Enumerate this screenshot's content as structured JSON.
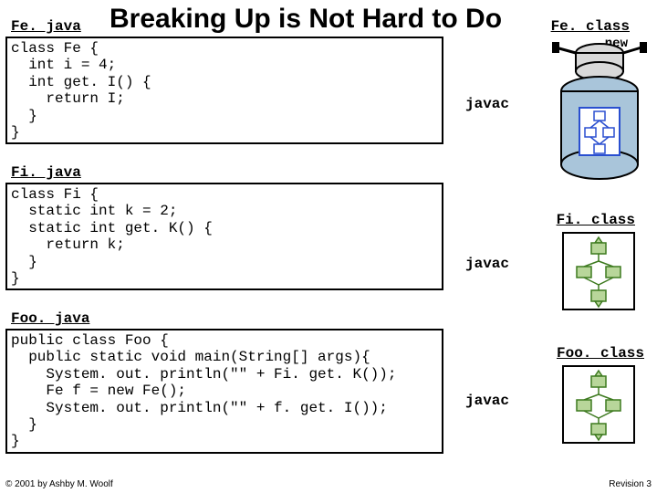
{
  "title": "Breaking Up is Not Hard to Do",
  "files": {
    "fe": {
      "label": "Fe. java",
      "code": "class Fe {\n  int i = 4;\n  int get. I() {\n    return I;\n  }\n}",
      "compiler": "javac",
      "class_label": "Fe. class"
    },
    "fi": {
      "label": "Fi. java",
      "code": "class Fi {\n  static int k = 2;\n  static int get. K() {\n    return k;\n  }\n}",
      "compiler": "javac",
      "class_label": "Fi. class"
    },
    "foo": {
      "label": "Foo. java",
      "code": "public class Foo {\n  public static void main(String[] args){\n    System. out. println(\"\" + Fi. get. K());\n    Fe f = new Fe();\n    System. out. println(\"\" + f. get. I());\n  }\n}",
      "compiler": "javac",
      "class_label": "Foo. class"
    }
  },
  "new_label": "new",
  "footer": {
    "copyright": "© 2001 by Ashby M. Woolf",
    "revision": "Revision 3"
  }
}
